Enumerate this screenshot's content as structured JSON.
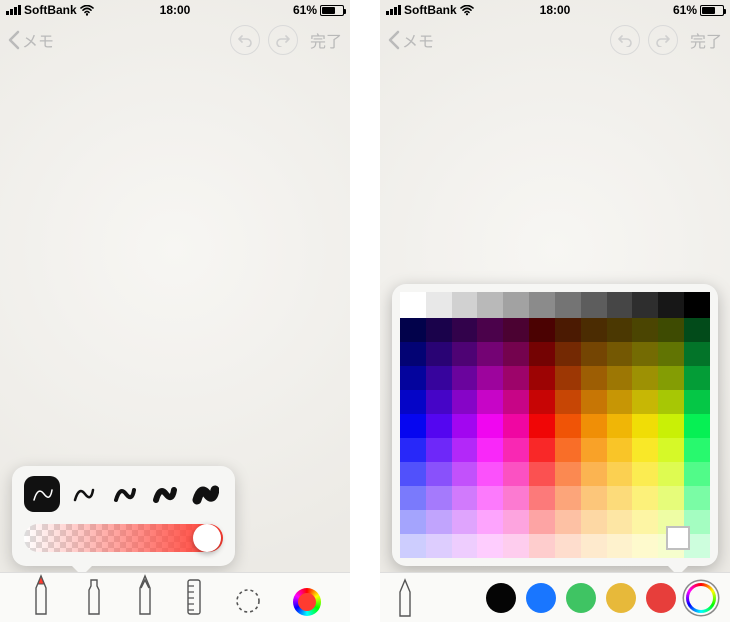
{
  "status_bar": {
    "carrier": "SoftBank",
    "time": "18:00",
    "battery_pct": "61%",
    "battery_fill_width": "60%"
  },
  "nav": {
    "back_label": "メモ",
    "done_label": "完了"
  },
  "left": {
    "stroke_weights": [
      1.5,
      2.5,
      4,
      6,
      9
    ],
    "selected_stroke_index": 0,
    "opacity_value": 1.0,
    "tools": [
      "pen",
      "marker",
      "pencil",
      "ruler",
      "lasso",
      "color"
    ]
  },
  "right": {
    "swatches": [
      {
        "name": "black",
        "hex": "#050505"
      },
      {
        "name": "blue",
        "hex": "#1976ff"
      },
      {
        "name": "green",
        "hex": "#3fc463"
      },
      {
        "name": "yellow",
        "hex": "#e7b93a"
      },
      {
        "name": "red",
        "hex": "#e73e3b"
      },
      {
        "name": "rainbow",
        "hex": null
      }
    ],
    "selected_swatch_index": 5,
    "grid": {
      "gray_row_count": 12,
      "hues": [
        240,
        260,
        280,
        300,
        320,
        0,
        20,
        35,
        45,
        55,
        70,
        140
      ],
      "rows_per_hue": 10
    }
  }
}
